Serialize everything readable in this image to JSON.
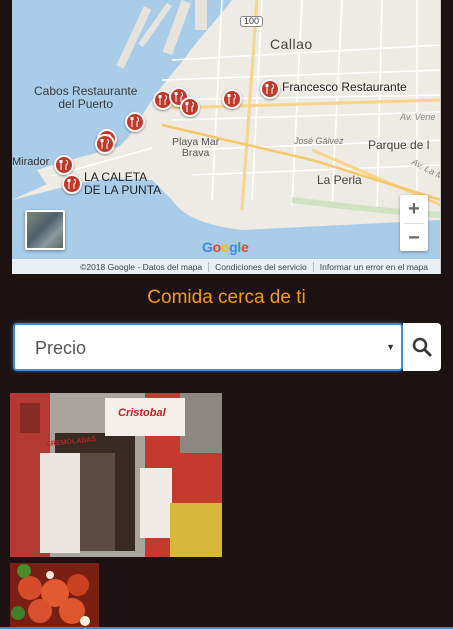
{
  "map": {
    "labels": {
      "callao": "Callao",
      "cabos": "Cabos Restaurante\ndel Puerto",
      "francesco": "Francesco Restaurante",
      "playa": "Playa Mar\nBrava",
      "jose": "José Gálvez",
      "parque": "Parque de l",
      "ven": "Av. Vene",
      "avla": "Av. La M",
      "mirador": "Mirador",
      "caleta": "LA CALETA\nDE LA PUNTA",
      "perla": "La Perla",
      "road": "100"
    },
    "zoom_in": "+",
    "zoom_out": "−",
    "google": [
      "G",
      "o",
      "o",
      "g",
      "l",
      "e"
    ],
    "attribution": {
      "copyright": "©2018 Google - Datos del mapa",
      "terms": "Condiciones del servicio",
      "report": "Informar un error en el mapa"
    },
    "pin_color": "#c0392b",
    "pin_icon": "fork-knife-icon"
  },
  "section_title": "Comida cerca de ti",
  "filter": {
    "selected": "Precio",
    "caret": "▼",
    "accent": "#3b8fd8"
  },
  "search": {
    "icon": "search-icon"
  },
  "photos": {
    "main_signs": [
      "CREMOLADAS",
      "Cristobal"
    ],
    "accent_text": "#f39c12"
  }
}
